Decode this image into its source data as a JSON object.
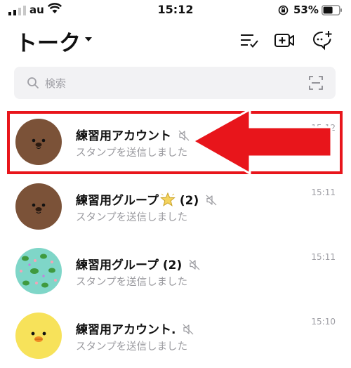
{
  "status_bar": {
    "carrier": "au",
    "time": "15:12",
    "battery": "53%",
    "icons": [
      "signal-icon",
      "wifi-icon",
      "rotation-lock-icon",
      "battery-icon"
    ]
  },
  "header": {
    "title": "トーク",
    "icons": [
      "title-dropdown-icon",
      "edit-list-icon",
      "video-call-icon",
      "add-chat-icon"
    ]
  },
  "search": {
    "placeholder": "検索",
    "icons": [
      "search-icon",
      "scan-icon"
    ]
  },
  "chats": [
    {
      "name": "練習用アカウント",
      "preview": "スタンプを送信しました",
      "time": "15:12",
      "muted": true,
      "avatar": "bear",
      "highlighted": true
    },
    {
      "name": "練習用グループ",
      "emoji": "star",
      "count": "(2)",
      "preview": "スタンプを送信しました",
      "time": "15:11",
      "muted": true,
      "avatar": "bear"
    },
    {
      "name": "練習用グループ",
      "count": "(2)",
      "preview": "スタンプを送信しました",
      "time": "15:11",
      "muted": true,
      "avatar": "frog-pattern"
    },
    {
      "name": "練習用アカウント.",
      "preview": "スタンプを送信しました",
      "time": "15:10",
      "muted": true,
      "avatar": "chick"
    }
  ],
  "annotation": {
    "color": "#e8151b",
    "type": "highlight-box-with-arrow"
  }
}
